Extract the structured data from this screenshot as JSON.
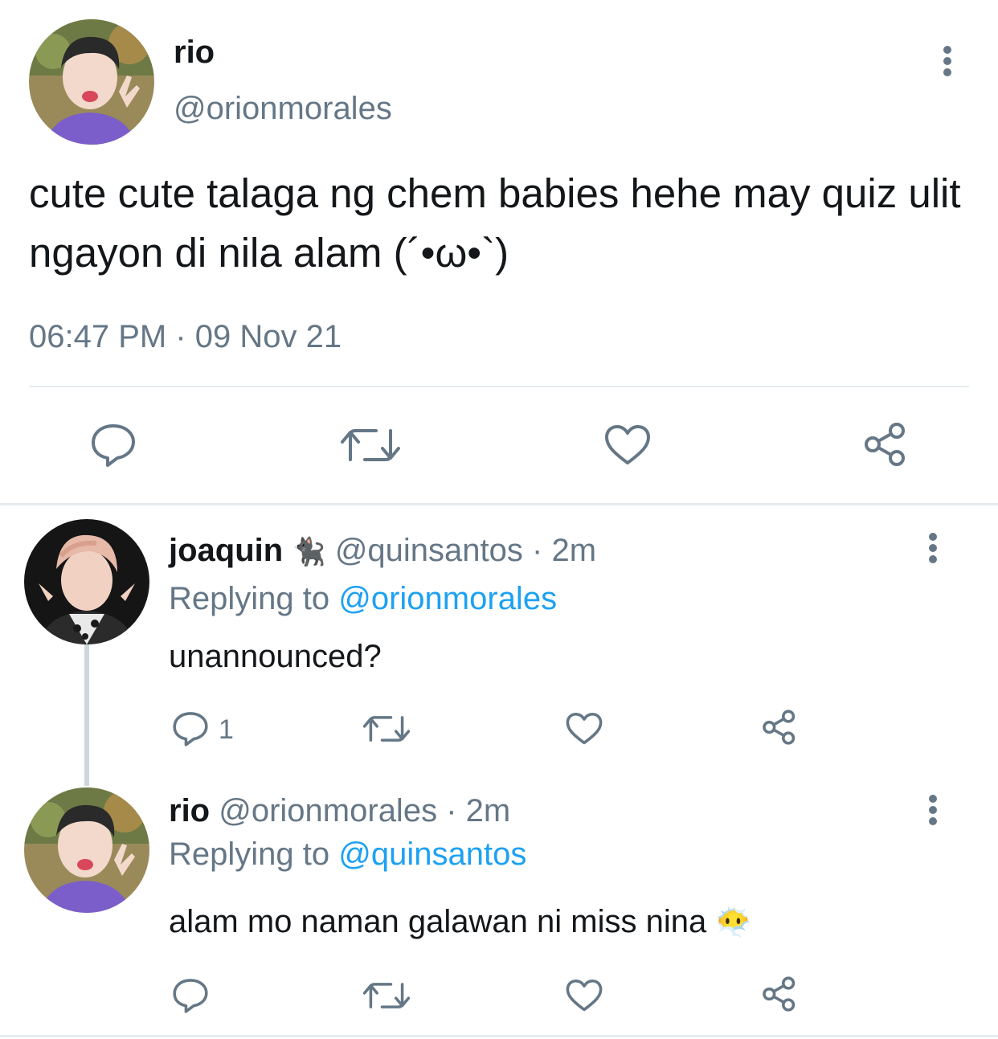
{
  "main_tweet": {
    "display_name": "rio",
    "handle": "@orionmorales",
    "text": "cute cute talaga ng chem babies hehe may quiz ulit ngayon di nila alam (´•ω•`)",
    "timestamp": "06:47 PM · 09 Nov 21",
    "actions": [
      "reply-icon",
      "retweet-icon",
      "like-icon",
      "share-icon"
    ]
  },
  "replies": [
    {
      "display_name": "joaquin",
      "badge_emoji": "🐈‍⬛",
      "handle": "@quinsantos",
      "separator": "·",
      "time": "2m",
      "replying_prefix": "Replying to",
      "replying_to": "@orionmorales",
      "text": "unannounced?",
      "reply_count": "1"
    },
    {
      "display_name": "rio",
      "handle": "@orionmorales",
      "separator": "·",
      "time": "2m",
      "replying_prefix": "Replying to",
      "replying_to": "@quinsantos",
      "text": "alam mo naman galawan ni miss nina",
      "emoji": "😶‍🌫️",
      "reply_count": ""
    }
  ],
  "colors": {
    "accent": "#1da1f2",
    "secondary_text": "#657786",
    "icon_gray": "#657786",
    "divider": "#e6ecf0",
    "thread_line": "#ccd6dd"
  }
}
